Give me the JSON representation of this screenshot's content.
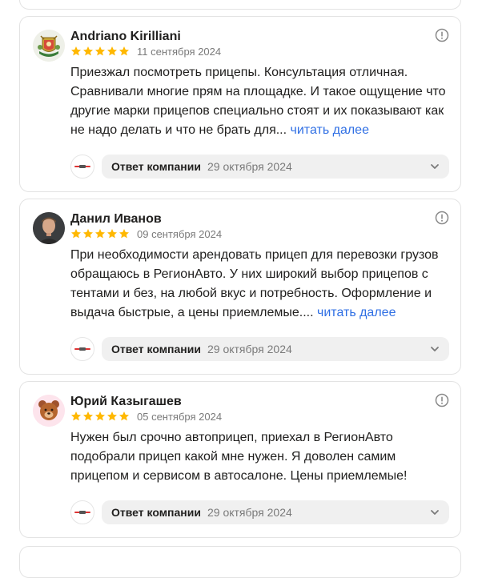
{
  "colors": {
    "star": "#ffb800",
    "link": "#2f6fe4",
    "muted": "#7a7a7a",
    "bar": "#f0f0f0"
  },
  "reviews": [
    {
      "author": "Andriano Kirilliani",
      "rating": 5,
      "date": "11 сентября 2024",
      "text": "Приезжал посмотреть прицепы. Консультация отличная. Сравнивали многие прям на площадке. И такое ощущение что другие марки прицепов специально стоят и их показывают как не надо делать и что не брать для...",
      "more_label": "читать далее",
      "avatar_icon": "emblem-avatar-icon",
      "reply_label": "Ответ компании",
      "reply_date": "29 октября 2024"
    },
    {
      "author": "Данил Иванов",
      "rating": 5,
      "date": "09 сентября 2024",
      "text": "При необходимости арендовать прицеп для перевозки грузов обращаюсь в РегионАвто. У них широкий выбор прицепов с тентами и без, на любой вкус и потребность. Оформление и выдача быстрые, а цены приемлемые....",
      "more_label": "читать далее",
      "avatar_icon": "person-photo-avatar-icon",
      "reply_label": "Ответ компании",
      "reply_date": "29 октября 2024"
    },
    {
      "author": "Юрий Казыгашев",
      "rating": 5,
      "date": "05 сентября 2024",
      "text": "Нужен был срочно автоприцеп, приехал в РегионАвто подобрали прицеп какой мне нужен. Я доволен самим прицепом и сервисом в автосалоне. Цены приемлемые!",
      "more_label": "",
      "avatar_icon": "bear-emoji-avatar-icon",
      "reply_label": "Ответ компании",
      "reply_date": "29 октября 2024"
    }
  ]
}
